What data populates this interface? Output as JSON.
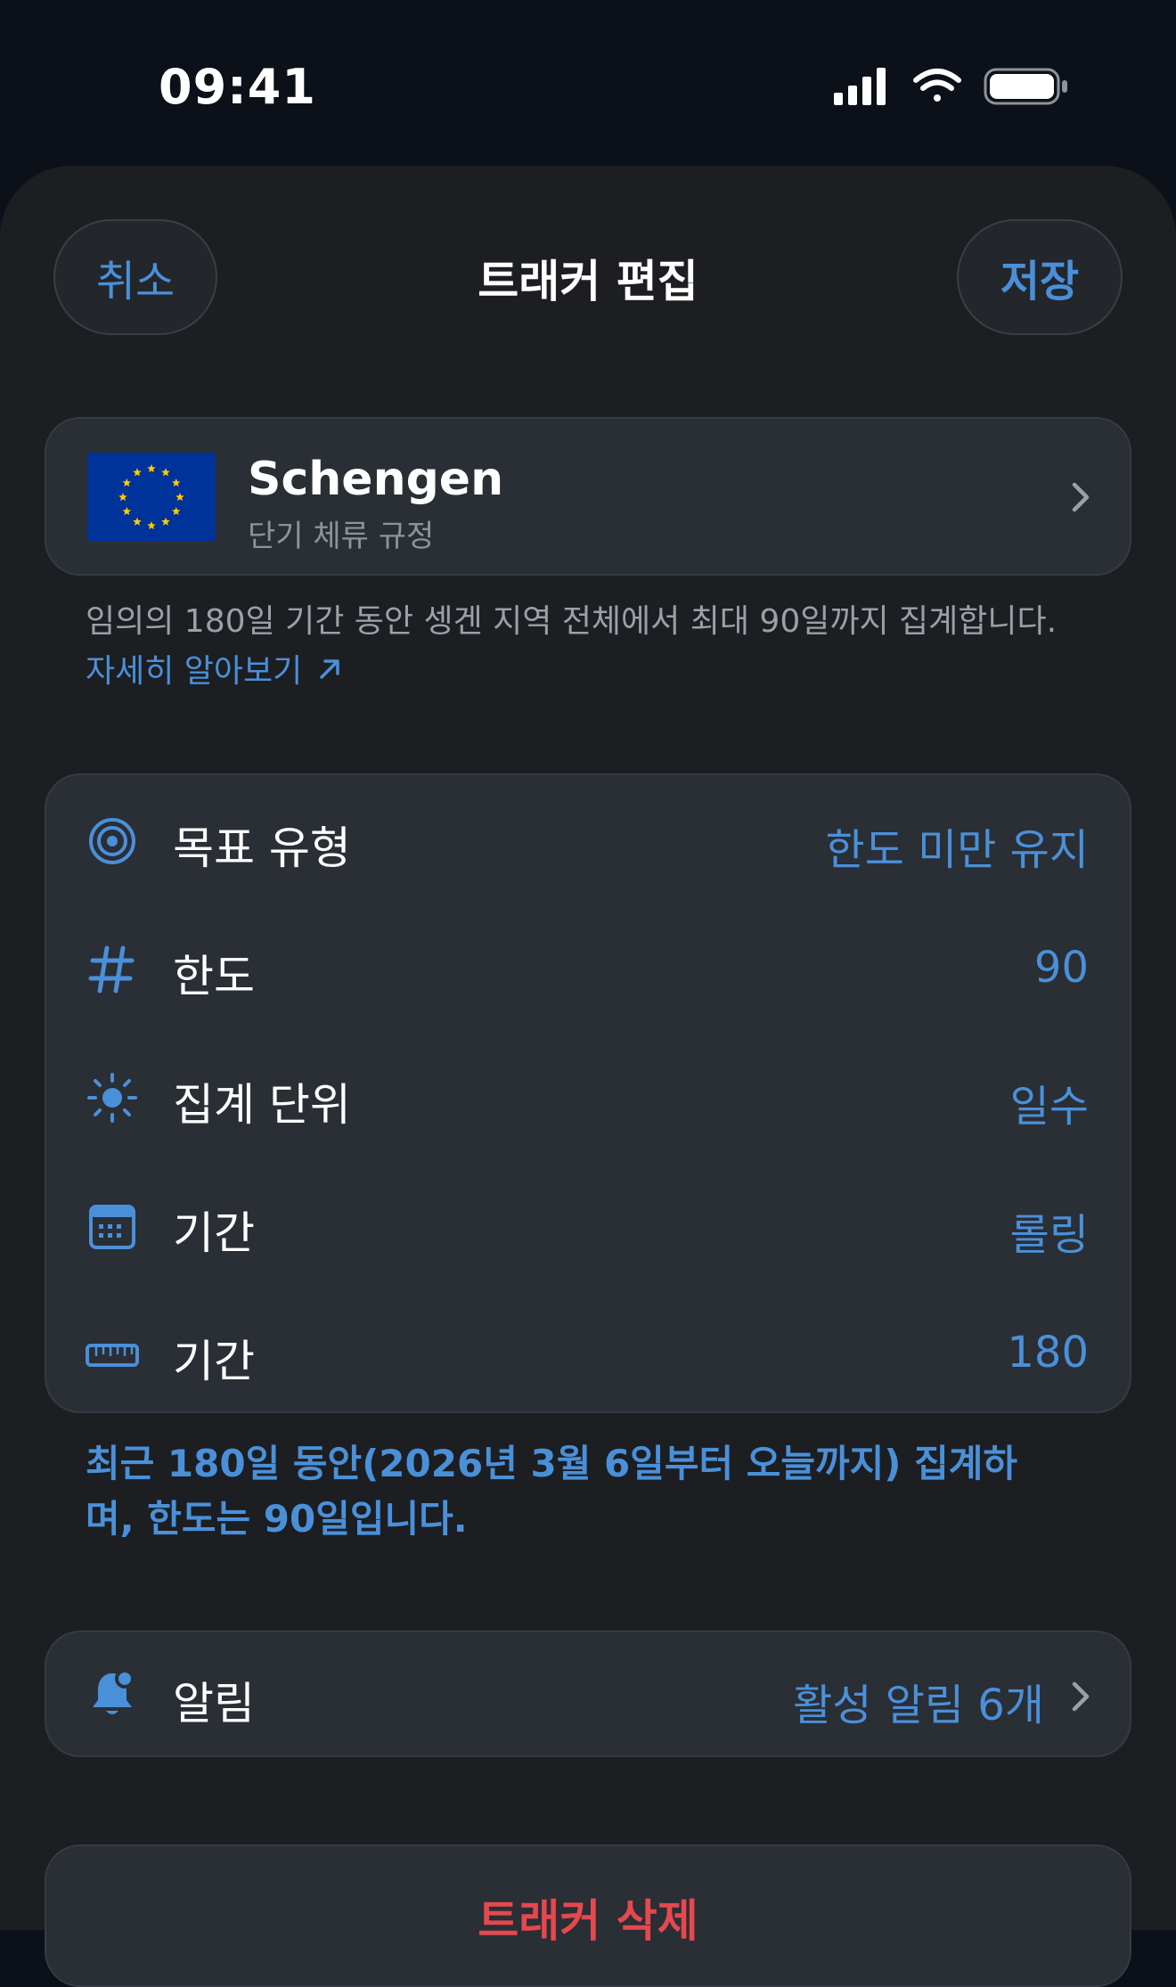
{
  "status_bar": {
    "time": "09:41",
    "icons": [
      "cellular-signal-icon",
      "wifi-icon",
      "battery-icon"
    ]
  },
  "nav": {
    "cancel_label": "취소",
    "title": "트래커 편집",
    "save_label": "저장"
  },
  "region": {
    "name": "Schengen",
    "subtitle": "단기 체류 규정",
    "flag_icon": "eu-flag-icon",
    "description": "임의의 180일 기간 동안 셍겐 지역 전체에서 최대 90일까지 집계합니다.",
    "learn_more": "자세히 알아보기"
  },
  "settings": [
    {
      "icon": "target-icon",
      "label": "목표 유형",
      "value": "한도 미만 유지"
    },
    {
      "icon": "hash-icon",
      "label": "한도",
      "value": "90"
    },
    {
      "icon": "sun-icon",
      "label": "집계 단위",
      "value": "일수"
    },
    {
      "icon": "calendar-icon",
      "label": "기간",
      "value": "롤링"
    },
    {
      "icon": "ruler-icon",
      "label": "기간",
      "value": "180"
    }
  ],
  "summary": "최근 180일 동안(2026년 3월 6일부터 오늘까지) 집계하며, 한도는 90일입니다.",
  "alerts": {
    "icon": "bell-badge-icon",
    "label": "알림",
    "value": "활성 알림 6개"
  },
  "delete": {
    "label": "트래커 삭제"
  },
  "colors": {
    "accent": "#4a90d9",
    "background": "#1c1e22",
    "card": "#2a2e35",
    "destructive": "#e5484d"
  }
}
